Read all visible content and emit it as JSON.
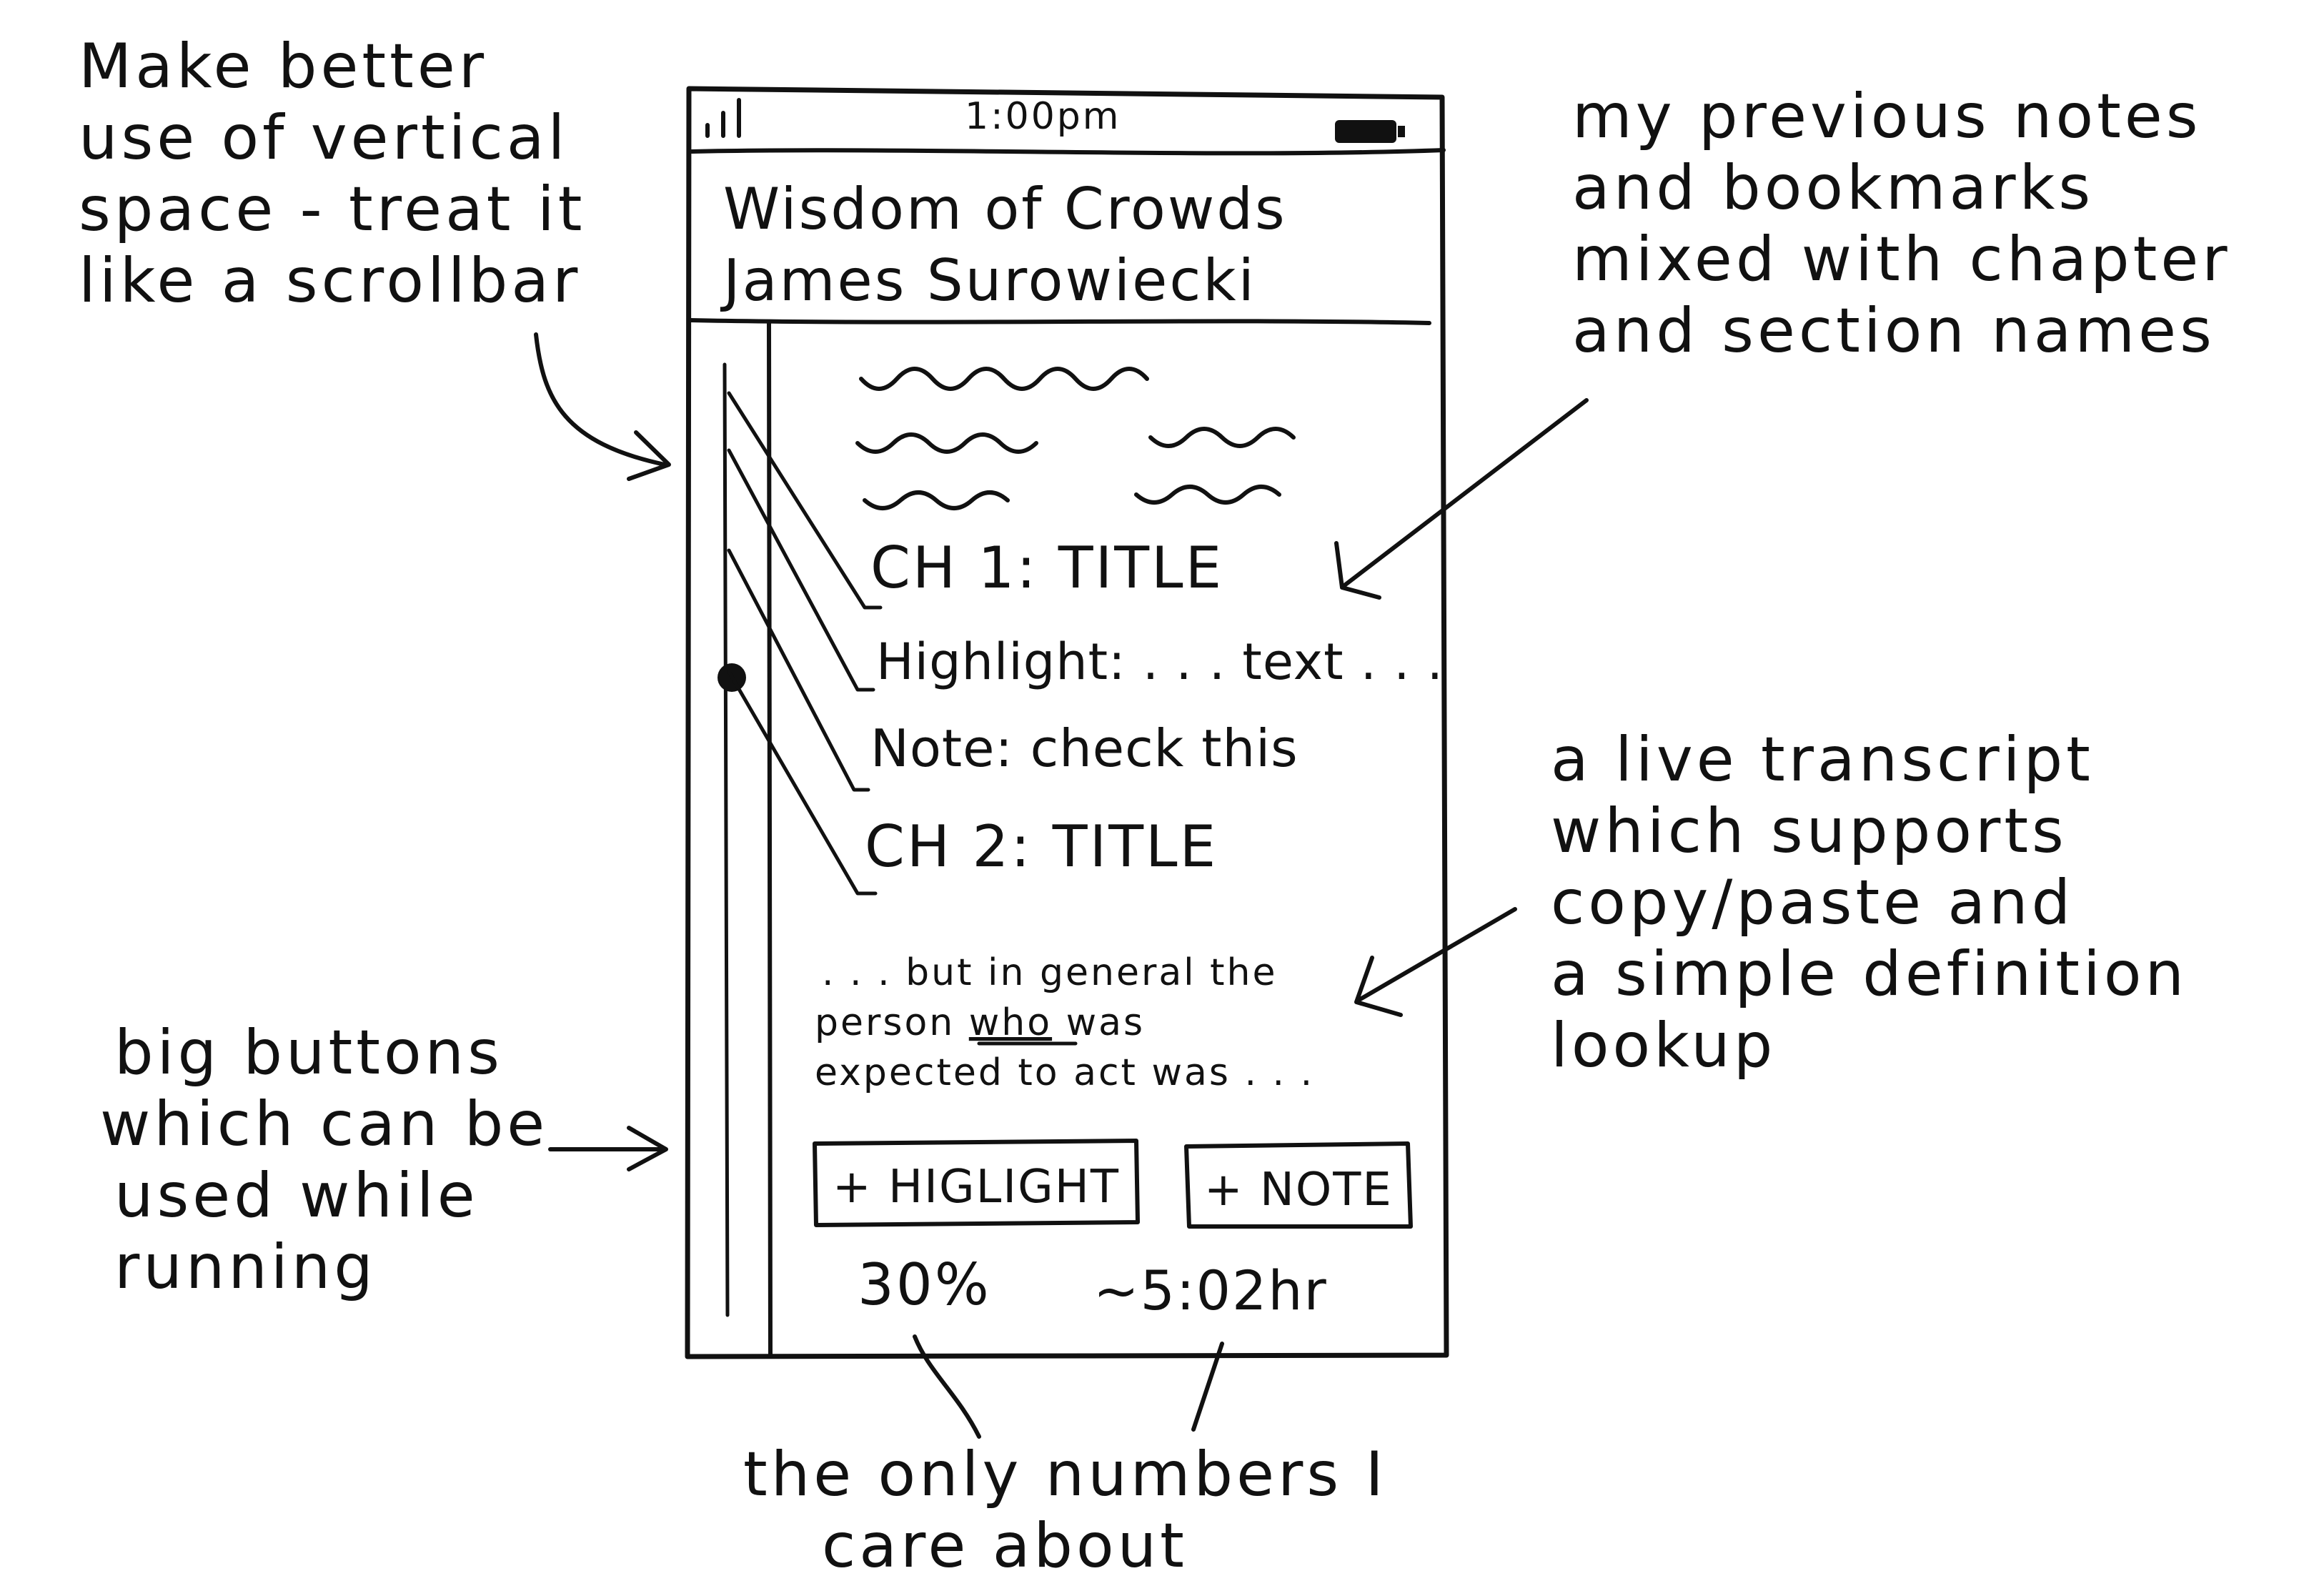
{
  "annotations": {
    "vertical_space": [
      "Make better",
      "use of vertical",
      "space - treat it",
      "like a scrollbar"
    ],
    "notes_bookmarks": [
      "my previous notes",
      "and bookmarks",
      "mixed with chapter",
      "and section names"
    ],
    "transcript": [
      "a live transcript",
      "which supports",
      "copy/paste and",
      "a simple definition",
      "lookup"
    ],
    "big_buttons": [
      "big buttons",
      "which can be",
      "used while",
      "running"
    ],
    "numbers": [
      "the only numbers I",
      "care about"
    ]
  },
  "phone": {
    "status_time": "1:00pm",
    "book_title": "Wisdom of Crowds",
    "book_author": "James Surowiecki",
    "toc": {
      "ch1": "CH 1: TITLE",
      "highlight": "Highlight: . . . text . . .",
      "note": "Note: check this",
      "ch2": "CH 2: TITLE"
    },
    "transcript": {
      "line1": ". . . but in general the",
      "line2_before": "person ",
      "line2_word": "who",
      "line2_after": " was",
      "line3": "expected to act was . . ."
    },
    "buttons": {
      "highlight": "+ HIGLIGHT",
      "note": "+ NOTE"
    },
    "progress_percent": "30%",
    "time_remaining": "~5:02hr"
  },
  "colors": {
    "ink": "#111111",
    "paper": "#ffffff"
  }
}
